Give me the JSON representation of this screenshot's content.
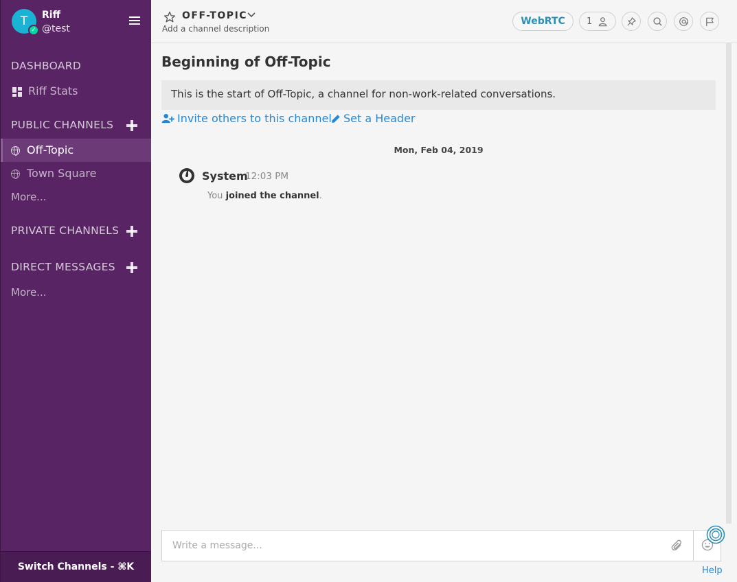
{
  "team": {
    "avatar_letter": "T",
    "name": "Riff",
    "username": "@test"
  },
  "sidebar": {
    "dashboard": {
      "title": "DASHBOARD",
      "items": [
        {
          "label": "Riff Stats"
        }
      ]
    },
    "public_channels": {
      "title": "PUBLIC CHANNELS",
      "items": [
        {
          "label": "Off-Topic",
          "active": true
        },
        {
          "label": "Town Square",
          "active": false
        }
      ],
      "more": "More..."
    },
    "private_channels": {
      "title": "PRIVATE CHANNELS"
    },
    "direct_messages": {
      "title": "DIRECT MESSAGES",
      "more": "More..."
    },
    "switch_channels": "Switch Channels - ⌘K"
  },
  "header": {
    "channel_name": "OFF-TOPIC",
    "description": "Add a channel description",
    "webrtc_label": "WebRTC",
    "member_count": "1",
    "icons": [
      "star-icon",
      "chevron-down-icon",
      "member-icon",
      "pin-icon",
      "search-icon",
      "at-mention-icon",
      "flag-icon"
    ]
  },
  "intro": {
    "title": "Beginning of Off-Topic",
    "text": "This is the start of Off-Topic, a channel for non-work-related conversations.",
    "invite_link": "Invite others to this channel",
    "header_link": "Set a Header"
  },
  "date_separator": "Mon, Feb 04, 2019",
  "post": {
    "author": "System",
    "time": "12:03 PM",
    "prefix": "You",
    "action": "joined the channel",
    "suffix": "."
  },
  "composer": {
    "placeholder": "Write a message...",
    "value": ""
  },
  "help_label": "Help",
  "colors": {
    "sidebar_bg": "#582463",
    "link": "#2389d7",
    "accent_webrtc": "#2d8fb3",
    "online": "#06d6a0"
  }
}
